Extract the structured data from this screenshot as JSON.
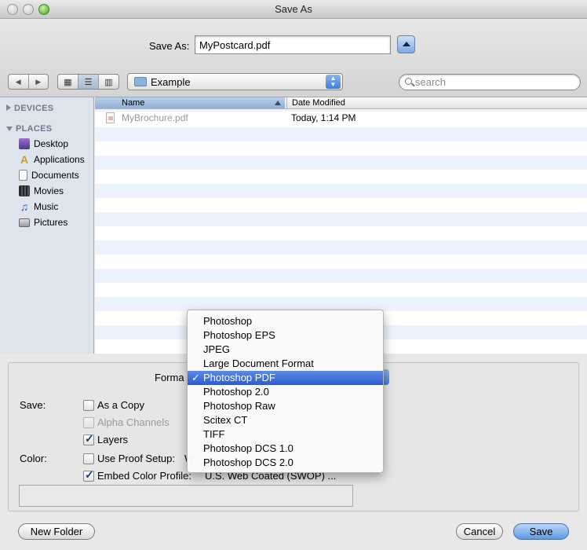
{
  "window": {
    "title": "Save As"
  },
  "save_as": {
    "label": "Save As:",
    "filename": "MyPostcard.pdf"
  },
  "toolbar": {
    "location": "Example",
    "search_placeholder": "search"
  },
  "sidebar": {
    "devices_header": "DEVICES",
    "places_header": "PLACES",
    "places": [
      {
        "label": "Desktop",
        "icon": "desktop-icon"
      },
      {
        "label": "Applications",
        "icon": "applications-icon"
      },
      {
        "label": "Documents",
        "icon": "documents-icon"
      },
      {
        "label": "Movies",
        "icon": "movies-icon"
      },
      {
        "label": "Music",
        "icon": "music-icon"
      },
      {
        "label": "Pictures",
        "icon": "pictures-icon"
      }
    ]
  },
  "file_list": {
    "columns": [
      "Name",
      "Date Modified"
    ],
    "rows": [
      {
        "name": "MyBrochure.pdf",
        "date": "Today, 1:14 PM"
      }
    ]
  },
  "options": {
    "format_label": "Forma",
    "save_label": "Save:",
    "as_copy": "As a Copy",
    "alpha_channels": "Alpha Channels",
    "layers": "Layers",
    "color_label": "Color:",
    "use_proof_setup": "Use Proof Setup:",
    "use_proof_setup_value": "W",
    "embed_color_profile": "Embed Color Profile:",
    "embed_profile_value": "U.S. Web Coated (SWOP) ..."
  },
  "format_menu": {
    "items": [
      "Photoshop",
      "Photoshop EPS",
      "JPEG",
      "Large Document Format",
      "Photoshop PDF",
      "Photoshop 2.0",
      "Photoshop Raw",
      "Scitex CT",
      "TIFF",
      "Photoshop DCS 1.0",
      "Photoshop DCS 2.0"
    ],
    "selected": "Photoshop PDF",
    "check_mark": "✓"
  },
  "buttons": {
    "new_folder": "New Folder",
    "cancel": "Cancel",
    "save": "Save"
  }
}
